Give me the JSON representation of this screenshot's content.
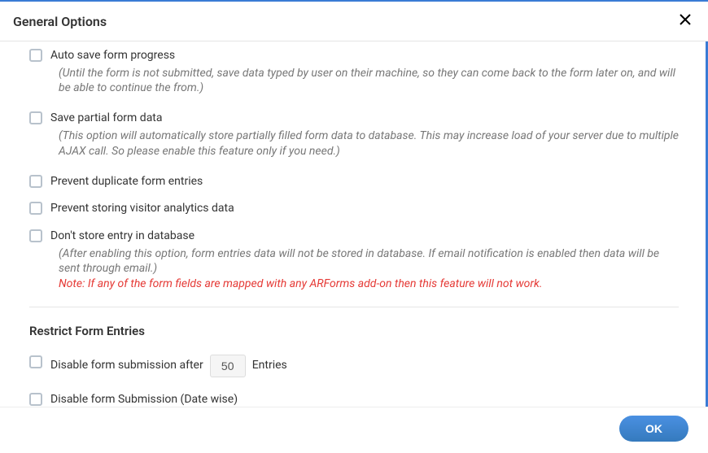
{
  "header": {
    "title": "General Options"
  },
  "options": {
    "autosave": {
      "label": "Auto save form progress",
      "desc": "(Until the form is not submitted, save data typed by user on their machine, so they can come back to the form later on, and will be able to continue the from.)"
    },
    "partial": {
      "label": "Save partial form data",
      "desc": "(This option will automatically store partially filled form data to database. This may increase load of your server due to multiple AJAX call. So please enable this feature only if you need.)"
    },
    "duplicate": {
      "label": "Prevent duplicate form entries"
    },
    "analytics": {
      "label": "Prevent storing visitor analytics data"
    },
    "nostore": {
      "label": "Don't store entry in database",
      "desc": "(After enabling this option, form entries data will not be stored in database. If email notification is enabled then data will be sent through email.)",
      "note": "Note: If any of the form fields are mapped with any ARForms add-on then this feature will not work."
    }
  },
  "restrict": {
    "title": "Restrict Form Entries",
    "disable_after": {
      "label_before": "Disable form submission after",
      "value": "50",
      "label_after": "Entries"
    },
    "disable_date": {
      "label": "Disable form Submission (Date wise)"
    }
  },
  "footer": {
    "ok": "OK"
  }
}
